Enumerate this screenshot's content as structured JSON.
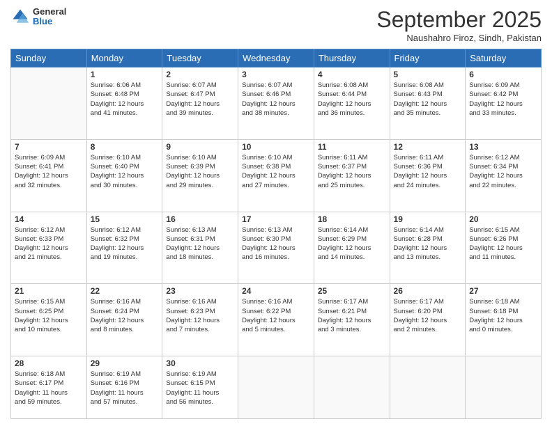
{
  "logo": {
    "general": "General",
    "blue": "Blue"
  },
  "header": {
    "month": "September 2025",
    "location": "Naushahro Firoz, Sindh, Pakistan"
  },
  "weekdays": [
    "Sunday",
    "Monday",
    "Tuesday",
    "Wednesday",
    "Thursday",
    "Friday",
    "Saturday"
  ],
  "weeks": [
    [
      {
        "day": "",
        "info": ""
      },
      {
        "day": "1",
        "info": "Sunrise: 6:06 AM\nSunset: 6:48 PM\nDaylight: 12 hours\nand 41 minutes."
      },
      {
        "day": "2",
        "info": "Sunrise: 6:07 AM\nSunset: 6:47 PM\nDaylight: 12 hours\nand 39 minutes."
      },
      {
        "day": "3",
        "info": "Sunrise: 6:07 AM\nSunset: 6:46 PM\nDaylight: 12 hours\nand 38 minutes."
      },
      {
        "day": "4",
        "info": "Sunrise: 6:08 AM\nSunset: 6:44 PM\nDaylight: 12 hours\nand 36 minutes."
      },
      {
        "day": "5",
        "info": "Sunrise: 6:08 AM\nSunset: 6:43 PM\nDaylight: 12 hours\nand 35 minutes."
      },
      {
        "day": "6",
        "info": "Sunrise: 6:09 AM\nSunset: 6:42 PM\nDaylight: 12 hours\nand 33 minutes."
      }
    ],
    [
      {
        "day": "7",
        "info": "Sunrise: 6:09 AM\nSunset: 6:41 PM\nDaylight: 12 hours\nand 32 minutes."
      },
      {
        "day": "8",
        "info": "Sunrise: 6:10 AM\nSunset: 6:40 PM\nDaylight: 12 hours\nand 30 minutes."
      },
      {
        "day": "9",
        "info": "Sunrise: 6:10 AM\nSunset: 6:39 PM\nDaylight: 12 hours\nand 29 minutes."
      },
      {
        "day": "10",
        "info": "Sunrise: 6:10 AM\nSunset: 6:38 PM\nDaylight: 12 hours\nand 27 minutes."
      },
      {
        "day": "11",
        "info": "Sunrise: 6:11 AM\nSunset: 6:37 PM\nDaylight: 12 hours\nand 25 minutes."
      },
      {
        "day": "12",
        "info": "Sunrise: 6:11 AM\nSunset: 6:36 PM\nDaylight: 12 hours\nand 24 minutes."
      },
      {
        "day": "13",
        "info": "Sunrise: 6:12 AM\nSunset: 6:34 PM\nDaylight: 12 hours\nand 22 minutes."
      }
    ],
    [
      {
        "day": "14",
        "info": "Sunrise: 6:12 AM\nSunset: 6:33 PM\nDaylight: 12 hours\nand 21 minutes."
      },
      {
        "day": "15",
        "info": "Sunrise: 6:12 AM\nSunset: 6:32 PM\nDaylight: 12 hours\nand 19 minutes."
      },
      {
        "day": "16",
        "info": "Sunrise: 6:13 AM\nSunset: 6:31 PM\nDaylight: 12 hours\nand 18 minutes."
      },
      {
        "day": "17",
        "info": "Sunrise: 6:13 AM\nSunset: 6:30 PM\nDaylight: 12 hours\nand 16 minutes."
      },
      {
        "day": "18",
        "info": "Sunrise: 6:14 AM\nSunset: 6:29 PM\nDaylight: 12 hours\nand 14 minutes."
      },
      {
        "day": "19",
        "info": "Sunrise: 6:14 AM\nSunset: 6:28 PM\nDaylight: 12 hours\nand 13 minutes."
      },
      {
        "day": "20",
        "info": "Sunrise: 6:15 AM\nSunset: 6:26 PM\nDaylight: 12 hours\nand 11 minutes."
      }
    ],
    [
      {
        "day": "21",
        "info": "Sunrise: 6:15 AM\nSunset: 6:25 PM\nDaylight: 12 hours\nand 10 minutes."
      },
      {
        "day": "22",
        "info": "Sunrise: 6:16 AM\nSunset: 6:24 PM\nDaylight: 12 hours\nand 8 minutes."
      },
      {
        "day": "23",
        "info": "Sunrise: 6:16 AM\nSunset: 6:23 PM\nDaylight: 12 hours\nand 7 minutes."
      },
      {
        "day": "24",
        "info": "Sunrise: 6:16 AM\nSunset: 6:22 PM\nDaylight: 12 hours\nand 5 minutes."
      },
      {
        "day": "25",
        "info": "Sunrise: 6:17 AM\nSunset: 6:21 PM\nDaylight: 12 hours\nand 3 minutes."
      },
      {
        "day": "26",
        "info": "Sunrise: 6:17 AM\nSunset: 6:20 PM\nDaylight: 12 hours\nand 2 minutes."
      },
      {
        "day": "27",
        "info": "Sunrise: 6:18 AM\nSunset: 6:18 PM\nDaylight: 12 hours\nand 0 minutes."
      }
    ],
    [
      {
        "day": "28",
        "info": "Sunrise: 6:18 AM\nSunset: 6:17 PM\nDaylight: 11 hours\nand 59 minutes."
      },
      {
        "day": "29",
        "info": "Sunrise: 6:19 AM\nSunset: 6:16 PM\nDaylight: 11 hours\nand 57 minutes."
      },
      {
        "day": "30",
        "info": "Sunrise: 6:19 AM\nSunset: 6:15 PM\nDaylight: 11 hours\nand 56 minutes."
      },
      {
        "day": "",
        "info": ""
      },
      {
        "day": "",
        "info": ""
      },
      {
        "day": "",
        "info": ""
      },
      {
        "day": "",
        "info": ""
      }
    ]
  ]
}
